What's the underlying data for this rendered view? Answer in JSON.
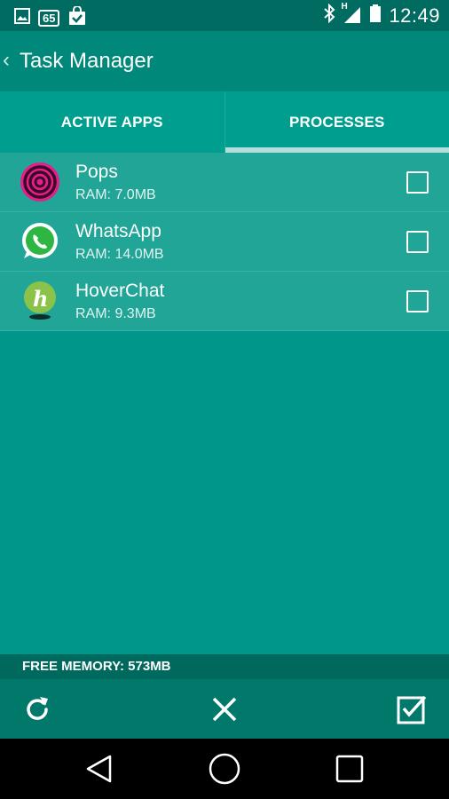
{
  "status_bar": {
    "notification_icons": [
      "image-icon",
      "battery-saver-65-icon",
      "shopping-bag-icon"
    ],
    "badge_text": "65",
    "network_label": "H",
    "time": "12:49"
  },
  "app_bar": {
    "title": "Task Manager"
  },
  "tabs": [
    {
      "label": "ACTIVE APPS",
      "selected": false
    },
    {
      "label": "PROCESSES",
      "selected": true
    }
  ],
  "processes": [
    {
      "name": "Pops",
      "ram": "RAM: 7.0MB",
      "icon": "pops-app-icon",
      "checked": false
    },
    {
      "name": "WhatsApp",
      "ram": "RAM: 14.0MB",
      "icon": "whatsapp-app-icon",
      "checked": false
    },
    {
      "name": "HoverChat",
      "ram": "RAM: 9.3MB",
      "icon": "hoverchat-app-icon",
      "checked": false
    }
  ],
  "footer": {
    "free_memory": "FREE MEMORY: 573MB"
  },
  "actions": [
    "refresh-icon",
    "close-icon",
    "select-all-check-icon"
  ],
  "colors": {
    "status_bar": "#006B60",
    "app_bar": "#00897B",
    "background": "#00968A",
    "tab_indicator": "#B2DFDB",
    "bottom_bar": "#00796B"
  }
}
